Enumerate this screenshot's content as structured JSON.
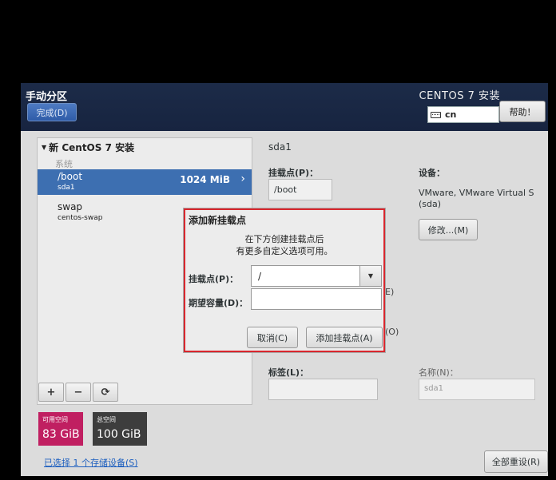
{
  "header": {
    "page_title": "手动分区",
    "done_button": "完成(D)",
    "os_title": "CENTOS 7 安装",
    "keyboard_layout": "cn",
    "help_button": "帮助！"
  },
  "left_panel": {
    "group_title": "新 CentOS 7 安装",
    "section_label": "系统",
    "mounts": [
      {
        "name": "/boot",
        "device": "sda1",
        "size": "1024 MiB",
        "selected": true
      },
      {
        "name": "swap",
        "device": "centos-swap",
        "size": ""
      }
    ],
    "toolbar": {
      "add": "+",
      "remove": "−",
      "refresh": "⟳"
    }
  },
  "space": {
    "available_label": "可用空间",
    "available_value": "83 GiB",
    "total_label": "总空间",
    "total_value": "100 GiB"
  },
  "storage_link": "已选择 1 个存储设备(S)",
  "right_panel": {
    "device_title": "sda1",
    "mount_point_label": "挂载点(P)：",
    "mount_point_value": "/boot",
    "device_label": "设备：",
    "device_value": "VMware, VMware Virtual S (sda)",
    "modify_button": "修改...(M)",
    "fragment_e": "E)",
    "fragment_o": "(O)",
    "tag_label": "标签(L)：",
    "name_label": "名称(N)：",
    "name_value": "sda1",
    "reset_button": "全部重设(R)"
  },
  "dialog": {
    "title": "添加新挂载点",
    "description_line1": "在下方创建挂载点后",
    "description_line2": "有更多自定义选项可用。",
    "mount_point_label": "挂载点(P)：",
    "mount_point_value": "/",
    "capacity_label": "期望容量(D)：",
    "capacity_value": "",
    "cancel_button": "取消(C)",
    "add_button": "添加挂载点(A)"
  },
  "colors": {
    "header_bg": "#1c2b48",
    "selection": "#3d6fb1",
    "available_space": "#c01f61",
    "total_space": "#3d3d3d",
    "dialog_highlight": "#d9272e"
  }
}
